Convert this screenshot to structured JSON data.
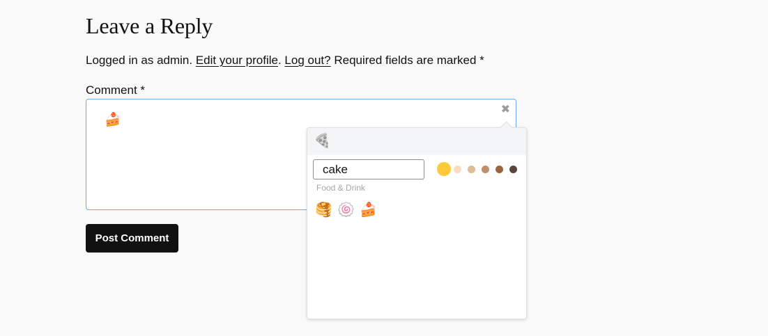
{
  "reply": {
    "title": "Leave a Reply",
    "logged_in_prefix": "Logged in as admin. ",
    "edit_profile_link": "Edit your profile",
    "after_edit": ". ",
    "logout_link": "Log out?",
    "required_note": " Required fields are marked *"
  },
  "comment": {
    "label": "Comment *",
    "content": "🍰",
    "clear_icon": "✖"
  },
  "post_button": {
    "label": "Post Comment"
  },
  "picker": {
    "category_icon": "🍕",
    "search_value": "cake",
    "section_label": "Food & Drink",
    "skin_tones": [
      "#ffc93a",
      "#fadcbc",
      "#e0bb95",
      "#bf8f68",
      "#9b643d",
      "#594539"
    ],
    "results": [
      "🥞",
      "🍥",
      "🍰"
    ]
  }
}
